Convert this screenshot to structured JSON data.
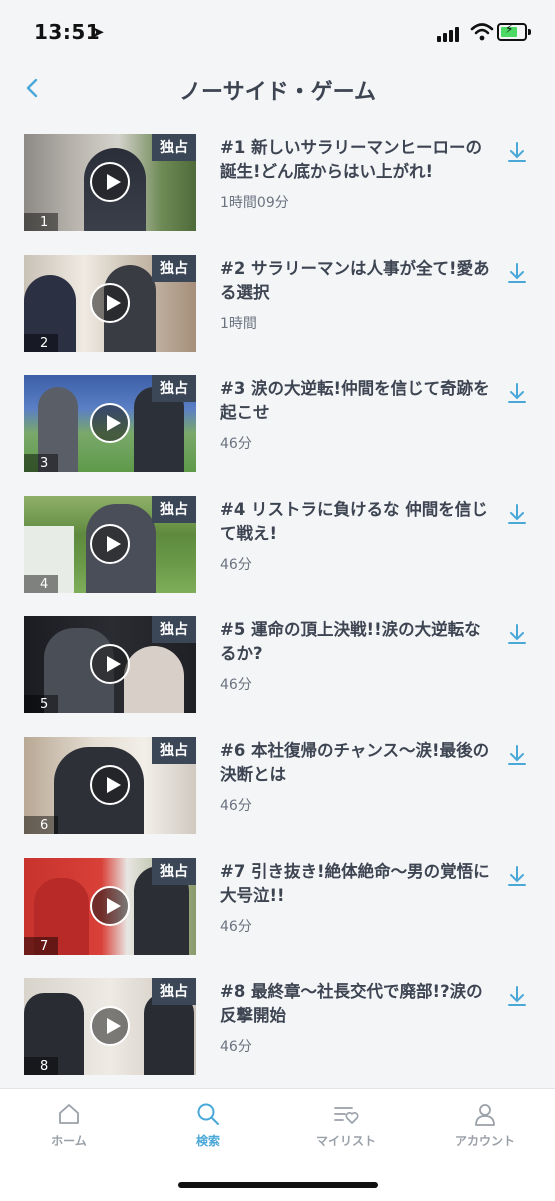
{
  "status": {
    "time": "13:51",
    "location_icon": "location-arrow-icon"
  },
  "header": {
    "title": "ノーサイド・ゲーム"
  },
  "badge_label": "独占",
  "episodes": [
    {
      "number": "1",
      "title": "#1 新しいサラリーマンヒーローの誕生!どん底からはい上がれ!",
      "duration": "1時間09分"
    },
    {
      "number": "2",
      "title": "#2 サラリーマンは人事が全て!愛ある選択",
      "duration": "1時間"
    },
    {
      "number": "3",
      "title": "#3 涙の大逆転!仲間を信じて奇跡を起こせ",
      "duration": "46分"
    },
    {
      "number": "4",
      "title": "#4 リストラに負けるな 仲間を信じて戦え!",
      "duration": "46分"
    },
    {
      "number": "5",
      "title": "#5 運命の頂上決戦!!涙の大逆転なるか?",
      "duration": "46分"
    },
    {
      "number": "6",
      "title": "#6 本社復帰のチャンス〜涙!最後の決断とは",
      "duration": "46分"
    },
    {
      "number": "7",
      "title": "#7 引き抜き!絶体絶命〜男の覚悟に大号泣!!",
      "duration": "46分"
    },
    {
      "number": "8",
      "title": "#8 最終章〜社長交代で廃部!?涙の反撃開始",
      "duration": "46分"
    }
  ],
  "tabs": [
    {
      "label": "ホーム",
      "icon": "home-icon",
      "active": false
    },
    {
      "label": "検索",
      "icon": "search-icon",
      "active": true
    },
    {
      "label": "マイリスト",
      "icon": "mylist-icon",
      "active": false
    },
    {
      "label": "アカウント",
      "icon": "account-icon",
      "active": false
    }
  ],
  "colors": {
    "accent": "#4aa8d8",
    "text": "#3d4552",
    "badge": "#3b4756",
    "background": "#f4f5f7"
  }
}
